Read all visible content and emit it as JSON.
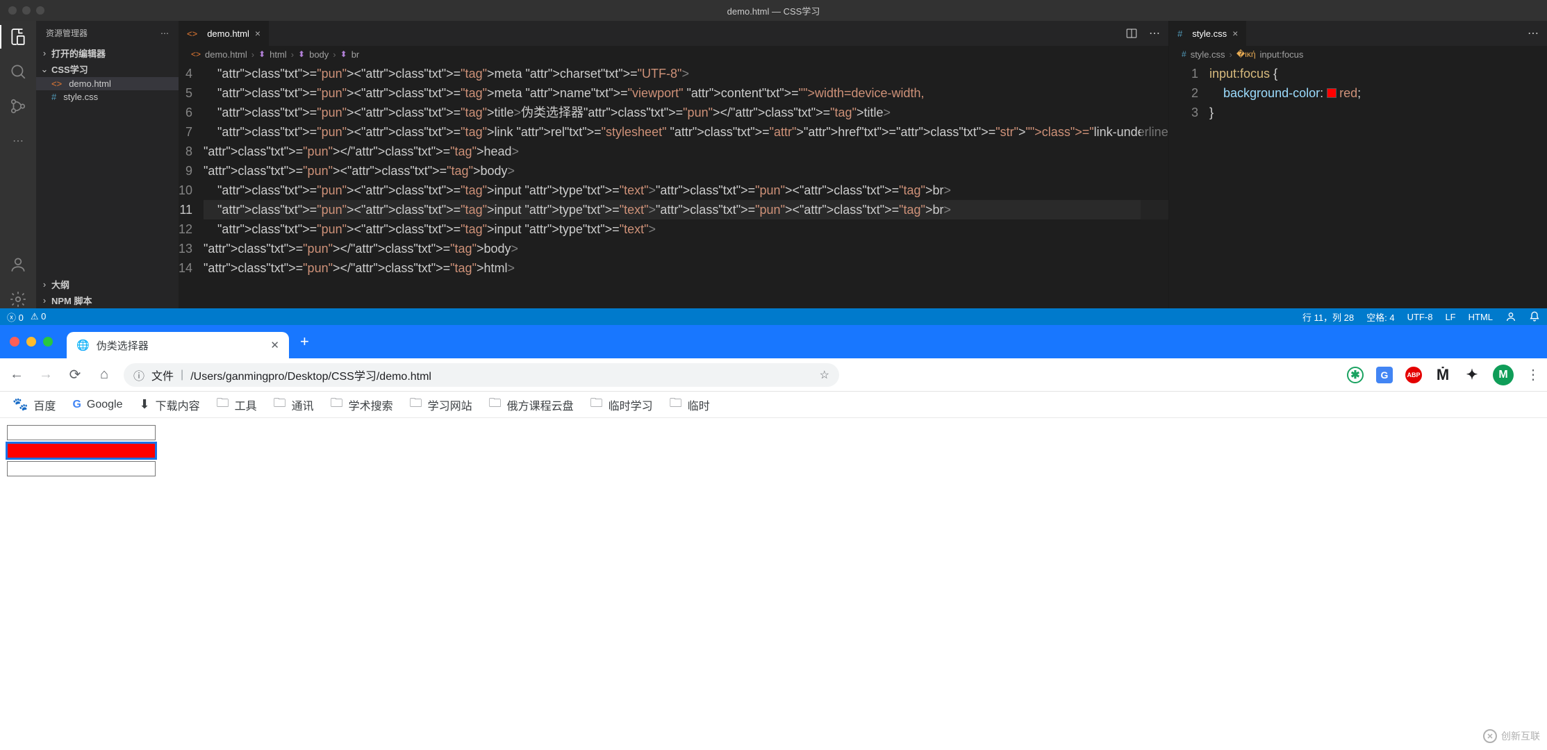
{
  "vscode": {
    "window_title": "demo.html — CSS学习",
    "sidebar": {
      "title": "资源管理器",
      "open_editors": "打开的编辑器",
      "project": "CSS学习",
      "files": [
        {
          "name": "demo.html",
          "icon": "html"
        },
        {
          "name": "style.css",
          "icon": "css"
        }
      ],
      "outline": "大纲",
      "npm": "NPM 脚本"
    },
    "editor1": {
      "tab": "demo.html",
      "breadcrumb": [
        "demo.html",
        "html",
        "body",
        "br"
      ],
      "line_start": 4,
      "lines": [
        "    <meta charset=\"UTF-8\">",
        "    <meta name=\"viewport\" content=\"width=device-width,",
        "    <title>伪类选择器</title>",
        "    <link rel=\"stylesheet\" href=\"style.css\">",
        "</head>",
        "<body>",
        "    <input type=\"text\"><br>",
        "    <input type=\"text\"><br>",
        "    <input type=\"text\">",
        "</body>",
        "</html>"
      ],
      "current_line_index": 7
    },
    "editor2": {
      "tab": "style.css",
      "breadcrumb": [
        "style.css",
        "input:focus"
      ],
      "line_start": 1,
      "lines": [
        "input:focus {",
        "    background-color: red;",
        "}"
      ]
    },
    "status": {
      "errors": "0",
      "warnings": "0",
      "cursor": "行 11，列 28",
      "spaces": "空格: 4",
      "encoding": "UTF-8",
      "eol": "LF",
      "lang": "HTML"
    }
  },
  "chrome": {
    "tab_title": "伪类选择器",
    "url_prefix": "文件",
    "url_path": "/Users/ganmingpro/Desktop/CSS学习/demo.html",
    "bookmarks": [
      {
        "icon": "baidu",
        "label": "百度"
      },
      {
        "icon": "google",
        "label": "Google"
      },
      {
        "icon": "download",
        "label": "下载内容"
      },
      {
        "icon": "folder",
        "label": "工具"
      },
      {
        "icon": "folder",
        "label": "通讯"
      },
      {
        "icon": "folder",
        "label": "学术搜索"
      },
      {
        "icon": "folder",
        "label": "学习网站"
      },
      {
        "icon": "folder",
        "label": "俄方课程云盘"
      },
      {
        "icon": "folder",
        "label": "临时学习"
      },
      {
        "icon": "folder",
        "label": "临时"
      }
    ],
    "avatar": "M"
  },
  "watermark": "创新互联"
}
